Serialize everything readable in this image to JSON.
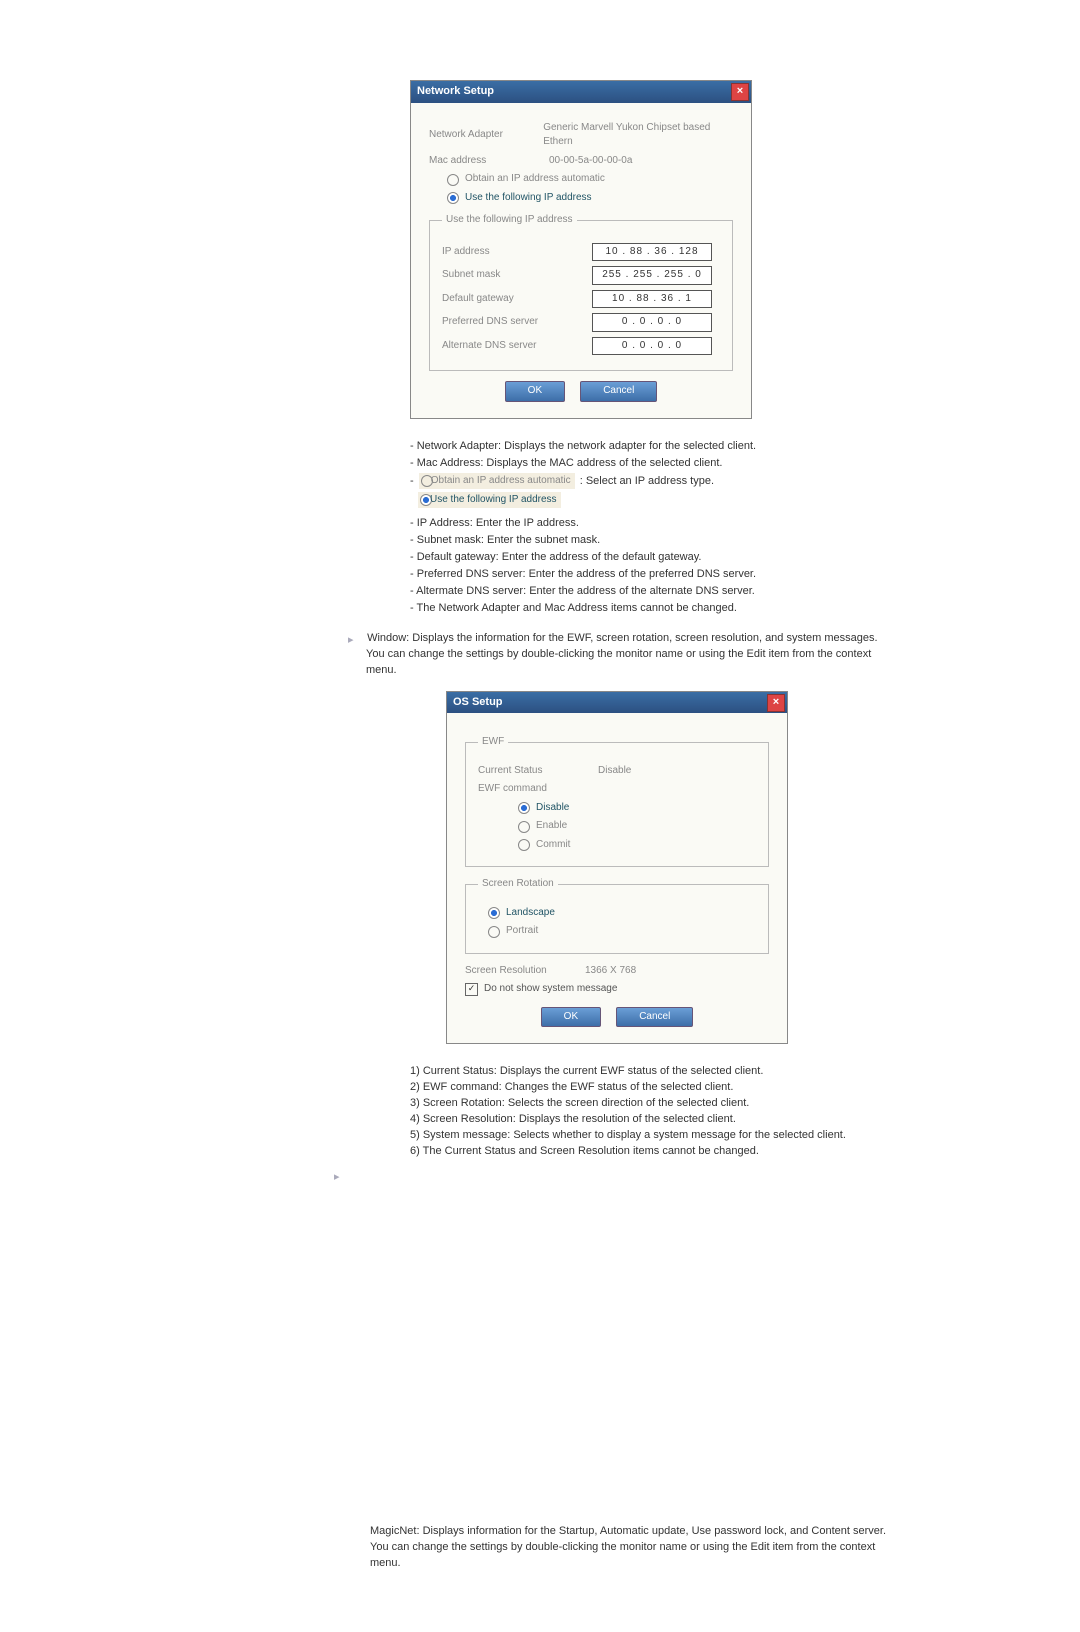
{
  "network_setup": {
    "title": "Network Setup",
    "adapter_label": "Network Adapter",
    "adapter_value": "Generic Marvell Yukon Chipset based Ethern",
    "mac_label": "Mac address",
    "mac_value": "00-00-5a-00-00-0a",
    "radio_auto": "Obtain an IP address automatic",
    "radio_manual": "Use the following IP address",
    "fieldset_legend": "Use the following IP address",
    "fields": {
      "ip_label": "IP address",
      "ip_value": "10 . 88 . 36 . 128",
      "subnet_label": "Subnet mask",
      "subnet_value": "255 . 255 . 255 . 0",
      "gateway_label": "Default gateway",
      "gateway_value": "10 . 88 . 36 . 1",
      "pdns_label": "Preferred DNS server",
      "pdns_value": "0 . 0 . 0 . 0",
      "adns_label": "Alternate DNS server",
      "adns_value": "0 . 0 . 0 . 0"
    },
    "ok": "OK",
    "cancel": "Cancel"
  },
  "network_list": {
    "l0": "Network Adapter: Displays the network adapter for the selected client.",
    "l1": "Mac Address: Displays the MAC address of the selected client.",
    "l2_suffix": " : Select an IP address type.",
    "l3": "IP Address: Enter the IP address.",
    "l4": "Subnet mask: Enter the subnet mask.",
    "l5": "Default gateway: Enter the address of the default gateway.",
    "l6": "Preferred DNS server: Enter the address of the preferred DNS server.",
    "l7": "Altermate DNS server: Enter the address of the alternate DNS server.",
    "l8": "The Network Adapter and Mac Address items cannot be changed."
  },
  "window_para": "Window: Displays the information for the EWF, screen rotation, screen resolution, and system messages. You can change the settings by double-clicking the monitor name or using the Edit item from the context menu.",
  "os_setup": {
    "title": "OS Setup",
    "ewf_legend": "EWF",
    "cur_label": "Current Status",
    "cur_value": "Disable",
    "cmd_label": "EWF command",
    "r_disable": "Disable",
    "r_enable": "Enable",
    "r_commit": "Commit",
    "rot_legend": "Screen Rotation",
    "r_land": "Landscape",
    "r_port": "Portrait",
    "res_label": "Screen Resolution",
    "res_value": "1366 X 768",
    "sysmsg": "Do not show system message",
    "ok": "OK",
    "cancel": "Cancel"
  },
  "os_list": {
    "l1": "1) Current Status: Displays the current EWF status of the selected client.",
    "l2": "2) EWF command: Changes the EWF status of the selected client.",
    "l3": "3) Screen Rotation: Selects the screen direction of the selected client.",
    "l4": "4) Screen Resolution: Displays the resolution of the selected client.",
    "l5": "5) System message: Selects whether to display a system message for the selected client.",
    "l6": "6) The Current Status and Screen Resolution items cannot be changed."
  },
  "magicnet_para": "MagicNet: Displays information for the Startup, Automatic update, Use password lock, and Content server. You can change the settings by double-clicking the monitor name or using the Edit item from the context menu."
}
